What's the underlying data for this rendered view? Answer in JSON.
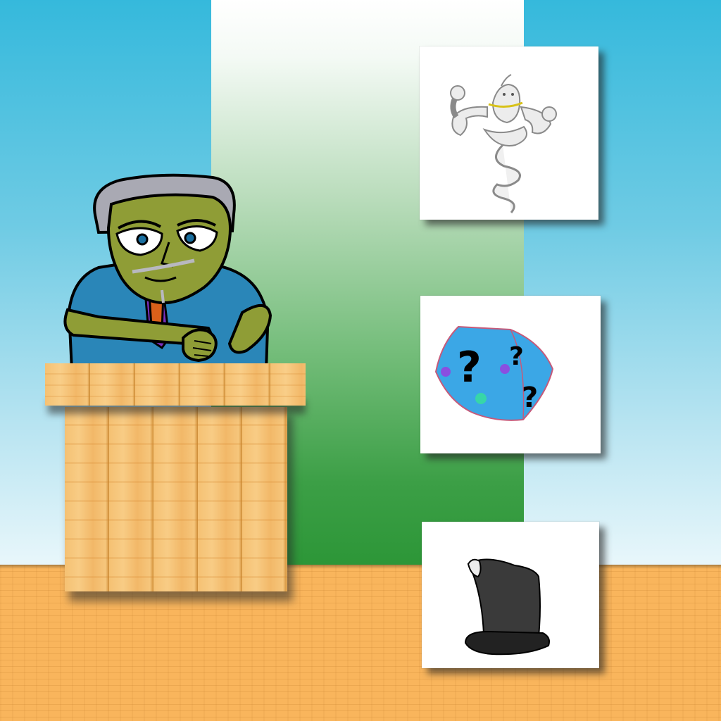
{
  "scene": {
    "colors": {
      "wall_top": "#35b9dc",
      "wall_bottom": "#e9f7fb",
      "banner_top": "#ffffff",
      "banner_bottom": "#2c9637",
      "floor": "#f9b55c",
      "podium_wood": "#f5c173"
    }
  },
  "host": {
    "icon": "game-show-host",
    "colors": {
      "skin": "#8f9d36",
      "hair": "#a9a9b3",
      "jacket": "#2a86b8",
      "tie": "#d9601a",
      "shirt": "#7b2fbf"
    }
  },
  "choices": [
    {
      "icon": "genie-icon"
    },
    {
      "icon": "mystery-box-icon",
      "colors": {
        "box": "#3ba7e6",
        "mark": "#000000"
      }
    },
    {
      "icon": "top-hat-icon",
      "colors": {
        "hat": "#2e2e2e"
      }
    }
  ]
}
